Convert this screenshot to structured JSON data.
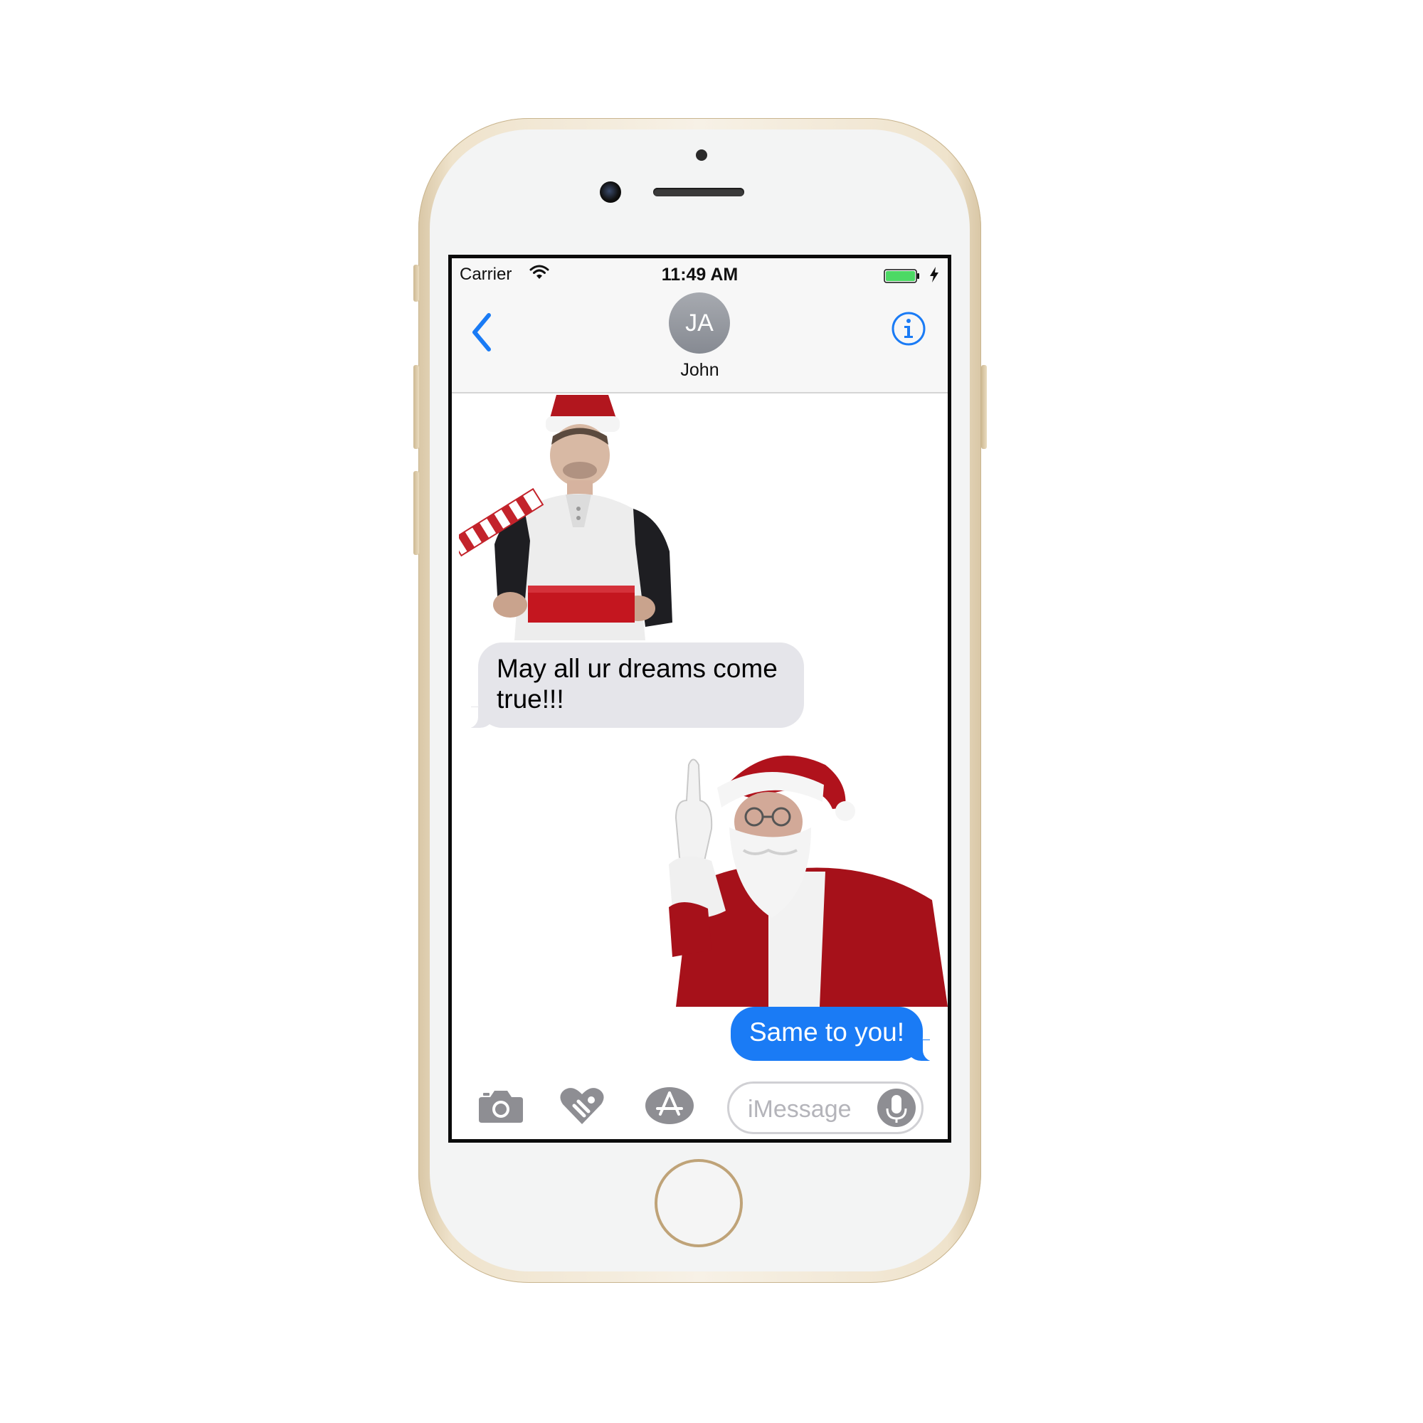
{
  "status_bar": {
    "carrier": "Carrier",
    "time": "11:49 AM",
    "icons": [
      "wifi-icon",
      "battery-icon",
      "charging-bolt-icon"
    ],
    "battery_color": "#4cd964"
  },
  "nav": {
    "back_icon": "chevron-left-icon",
    "avatar_initials": "JA",
    "contact_name": "John",
    "info_icon": "info-icon",
    "accent_color": "#1a7bf5"
  },
  "messages": [
    {
      "type": "sticker",
      "from": "contact",
      "description_icon": "sticker-man-opening-gift"
    },
    {
      "type": "text",
      "from": "contact",
      "text": "May all ur dreams come true!!!"
    },
    {
      "type": "sticker",
      "from": "me",
      "description_icon": "sticker-santa"
    },
    {
      "type": "text",
      "from": "me",
      "text": "Same to you!"
    }
  ],
  "input_bar": {
    "icons": [
      "camera-icon",
      "digital-touch-icon",
      "app-store-icon",
      "microphone-icon"
    ],
    "placeholder": "iMessage"
  },
  "colors": {
    "sent_bubble": "#1a7bf5",
    "received_bubble": "#e5e5ea",
    "phone_gold": "#d9c7a6"
  }
}
